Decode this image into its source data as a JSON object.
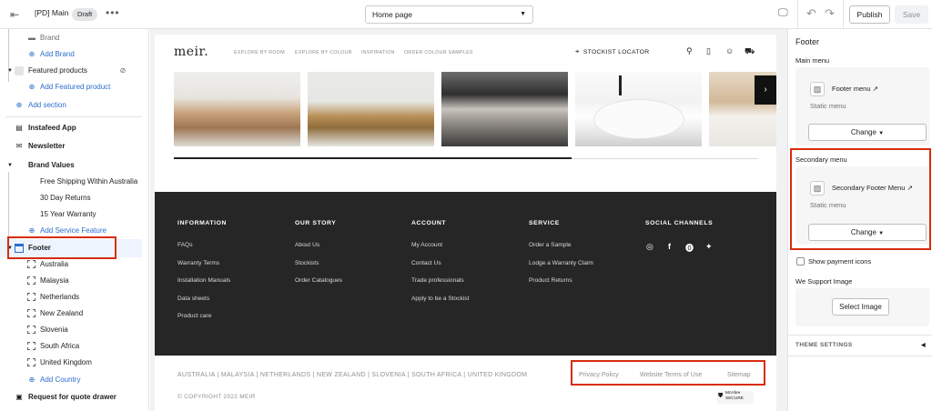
{
  "topbar": {
    "theme_name": "[PD] Main",
    "status_badge": "Draft",
    "more": "•••",
    "page_select": "Home page",
    "publish": "Publish",
    "save": "Save"
  },
  "sidebar": {
    "items": [
      {
        "label": "Brand",
        "type": "sub"
      },
      {
        "label": "Add Brand",
        "type": "add"
      },
      {
        "label": "Featured products",
        "type": "section"
      },
      {
        "label": "Add Featured product",
        "type": "add"
      },
      {
        "label": "Add section",
        "type": "add"
      },
      {
        "label": "Instafeed App",
        "type": "section"
      },
      {
        "label": "Newsletter",
        "type": "section"
      },
      {
        "label": "Brand Values",
        "type": "section"
      },
      {
        "label": "Free Shipping Within Australia",
        "type": "sub"
      },
      {
        "label": "30 Day Returns",
        "type": "sub"
      },
      {
        "label": "15 Year Warranty",
        "type": "sub"
      },
      {
        "label": "Add Service Feature",
        "type": "add"
      },
      {
        "label": "Footer",
        "type": "section"
      },
      {
        "label": "Australia",
        "type": "block"
      },
      {
        "label": "Malaysia",
        "type": "block"
      },
      {
        "label": "Netherlands",
        "type": "block"
      },
      {
        "label": "New Zealand",
        "type": "block"
      },
      {
        "label": "Slovenia",
        "type": "block"
      },
      {
        "label": "South Africa",
        "type": "block"
      },
      {
        "label": "United Kingdom",
        "type": "block"
      },
      {
        "label": "Add Country",
        "type": "add"
      },
      {
        "label": "Request for quote drawer",
        "type": "section"
      }
    ]
  },
  "store": {
    "logo": "meir.",
    "nav": [
      "EXPLORE BY ROOM",
      "EXPLORE BY COLOUR",
      "INSPIRATION",
      "ORDER COLOUR SAMPLES"
    ],
    "stockist": "STOCKIST LOCATOR",
    "carousel_progress": 0.68,
    "footer_columns": [
      {
        "title": "INFORMATION",
        "links": [
          "FAQs",
          "Warranty Terms",
          "Installation Manuals",
          "Data sheets",
          "Product care"
        ]
      },
      {
        "title": "OUR STORY",
        "links": [
          "About Us",
          "Stockists",
          "Order Catalogues"
        ]
      },
      {
        "title": "ACCOUNT",
        "links": [
          "My Account",
          "Contact Us",
          "Trade professionals",
          "Apply to be a Stockist"
        ]
      },
      {
        "title": "SERVICE",
        "links": [
          "Order a Sample",
          "Lodge a Warranty Claim",
          "Product Returns"
        ]
      },
      {
        "title": "SOCIAL CHANNELS",
        "links": []
      }
    ],
    "countries": "AUSTRALIA |  MALAYSIA |  NETHERLANDS |  NEW ZEALAND |  SLOVENIA |  SOUTH AFRICA |  UNITED KINGDOM",
    "legal": [
      "Privacy Policy",
      "Website Terms of Use",
      "Sitemap"
    ],
    "copyright": "© COPYRIGHT 2022 MEIR",
    "mcafee": "McAfee SECURE"
  },
  "settings": {
    "title": "Footer",
    "main_menu_label": "Main menu",
    "main_menu_name": "Footer menu",
    "main_menu_static": "Static menu",
    "change": "Change",
    "secondary_menu_label": "Secondary menu",
    "secondary_menu_name": "Secondary Footer Menu",
    "secondary_menu_static": "Static menu",
    "show_payment_icons": "Show payment icons",
    "show_payment_icons_checked": false,
    "we_support_image": "We Support Image",
    "select_image": "Select Image",
    "theme_settings": "THEME SETTINGS"
  },
  "colors": {
    "accent": "#2c6ecb",
    "highlight": "#d82c0d",
    "footer_bg": "#262626"
  }
}
